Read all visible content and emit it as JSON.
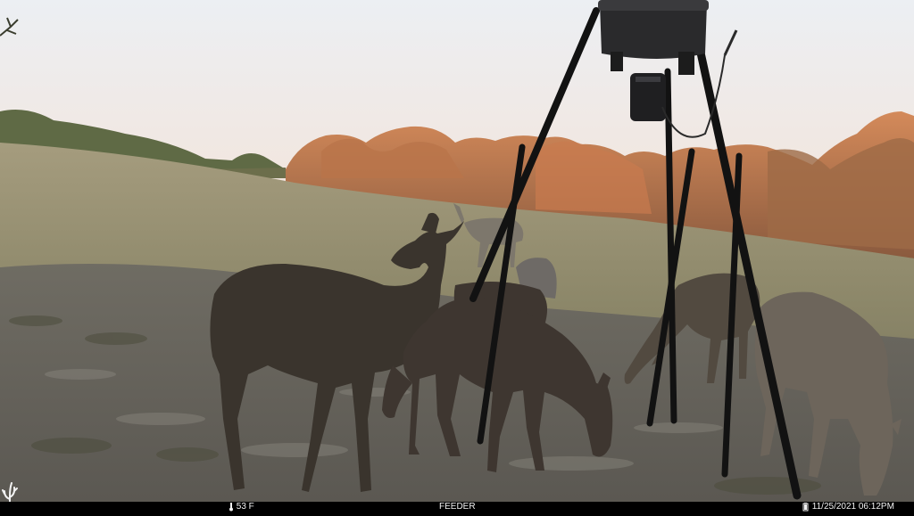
{
  "camera": {
    "temperature": "53 F",
    "camera_name": "FEEDER",
    "date": "11/25/2021",
    "time": "06:12PM"
  },
  "icons": {
    "brand_logo": "deer-antler-logo-icon",
    "thermometer": "thermometer-icon",
    "battery": "battery-icon"
  },
  "colors": {
    "sky_top": "#eef0f2",
    "sky_horizon": "#f4ddd0",
    "field_grass": "#8f8a6c",
    "ground_dirt": "#6f6a61",
    "bar_background": "#000000",
    "bar_text": "#f2f2f2"
  }
}
